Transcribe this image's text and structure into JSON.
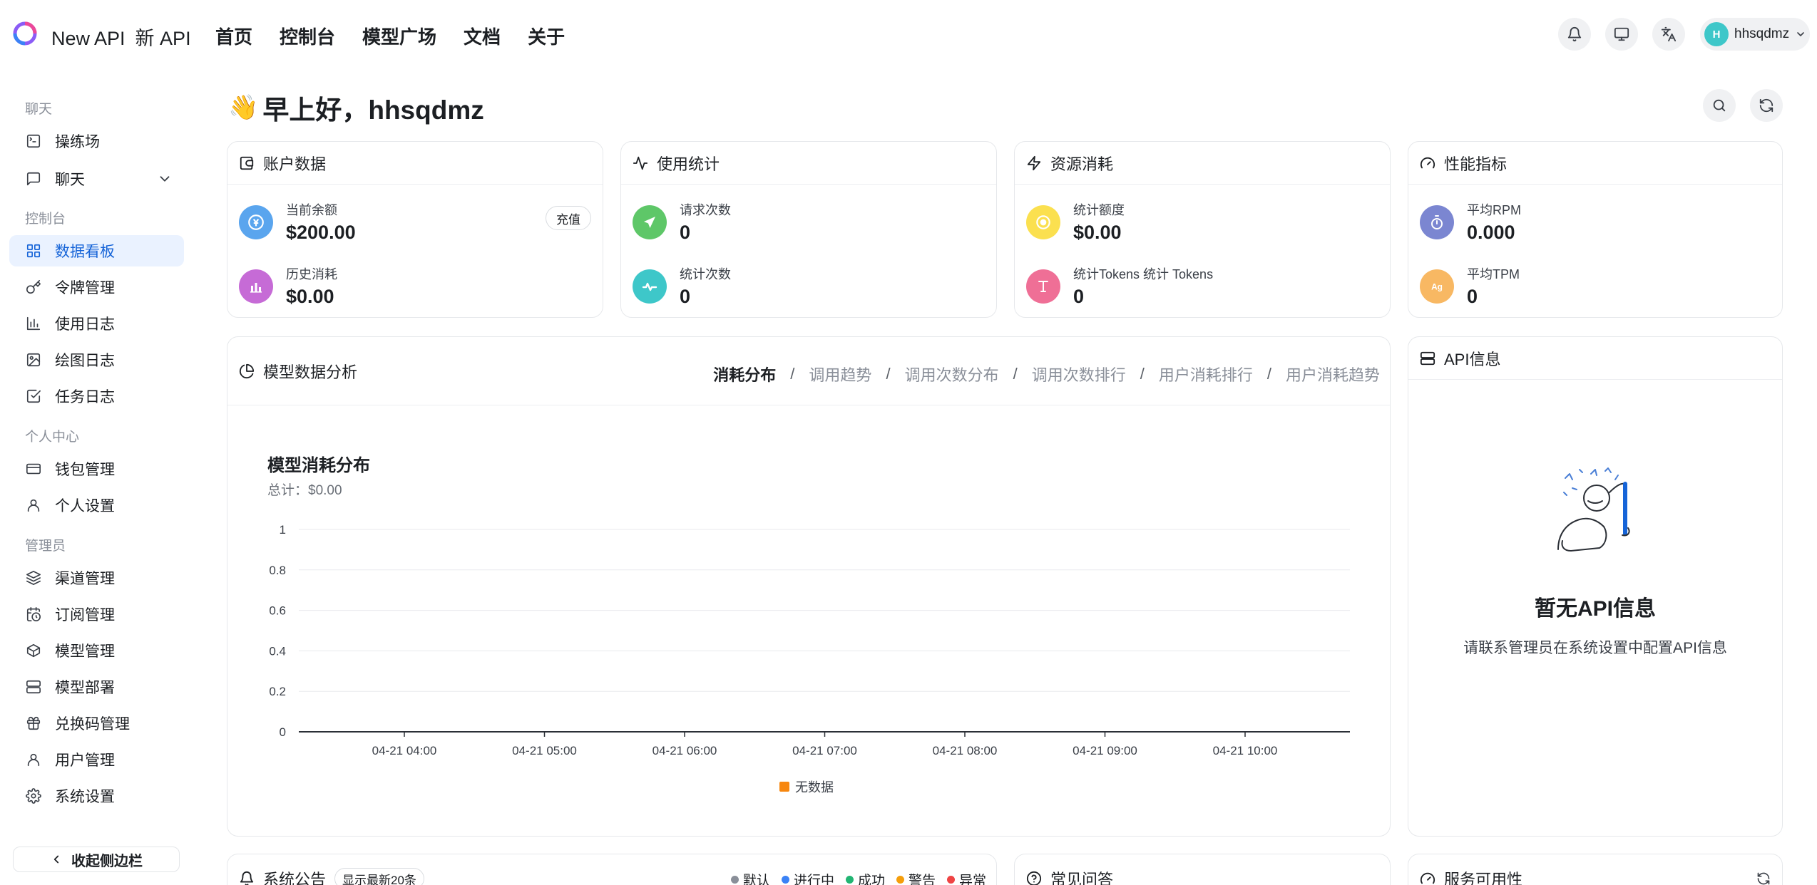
{
  "brand": {
    "name": "New API",
    "name_cn": "新 API"
  },
  "topnav": [
    "首页",
    "控制台",
    "模型广场",
    "文档",
    "关于"
  ],
  "user": {
    "initial": "H",
    "name": "hhsqdmz"
  },
  "sidebar": {
    "groups": [
      "聊天",
      "控制台",
      "个人中心",
      "管理员"
    ],
    "items": [
      "操练场",
      "聊天",
      "数据看板",
      "令牌管理",
      "使用日志",
      "绘图日志",
      "任务日志",
      "钱包管理",
      "个人设置",
      "渠道管理",
      "订阅管理",
      "模型管理",
      "模型部署",
      "兑换码管理",
      "用户管理",
      "系统设置"
    ],
    "collapse_label": "收起侧边栏"
  },
  "greeting": {
    "emoji": "👋",
    "text": "早上好，hhsqdmz"
  },
  "cards": {
    "account": {
      "title": "账户数据",
      "balance_label": "当前余额",
      "balance_value": "$200.00",
      "recharge": "充值",
      "spent_label": "历史消耗",
      "spent_value": "$0.00"
    },
    "usage": {
      "title": "使用统计",
      "requests_label": "请求次数",
      "requests_value": "0",
      "count_label": "统计次数",
      "count_value": "0"
    },
    "resource": {
      "title": "资源消耗",
      "quota_label": "统计额度",
      "quota_value": "$0.00",
      "tokens_label": "统计Tokens  统计 Tokens",
      "tokens_value": "0"
    },
    "performance": {
      "title": "性能指标",
      "rpm_label": "平均RPM",
      "rpm_value": "0.000",
      "tpm_label": "平均TPM",
      "tpm_value": "0"
    }
  },
  "analysis": {
    "title": "模型数据分析",
    "tabs": [
      "消耗分布",
      "调用趋势",
      "调用次数分布",
      "调用次数排行",
      "用户消耗排行",
      "用户消耗趋势"
    ],
    "active_tab": 0
  },
  "chart_data": {
    "type": "bar",
    "title": "模型消耗分布",
    "subtitle": "总计：$0.00",
    "categories": [
      "04-21 04:00",
      "04-21 05:00",
      "04-21 06:00",
      "04-21 07:00",
      "04-21 08:00",
      "04-21 09:00",
      "04-21 10:00"
    ],
    "series": [
      {
        "name": "无数据",
        "values": [
          0,
          0,
          0,
          0,
          0,
          0,
          0
        ],
        "color": "#f7870f"
      }
    ],
    "yticks": [
      "0",
      "0.2",
      "0.4",
      "0.6",
      "0.8",
      "1"
    ],
    "ylim": [
      0,
      1
    ],
    "grid": true,
    "legend": "bottom-center"
  },
  "api_info": {
    "title": "API信息",
    "empty_title": "暂无API信息",
    "empty_desc": "请联系管理员在系统设置中配置API信息"
  },
  "announcements": {
    "title": "系统公告",
    "badge": "显示最新20条",
    "legend": [
      {
        "label": "默认",
        "color": "#8a8f99"
      },
      {
        "label": "进行中",
        "color": "#3b82f6"
      },
      {
        "label": "成功",
        "color": "#22b573"
      },
      {
        "label": "警告",
        "color": "#f59e0b"
      },
      {
        "label": "异常",
        "color": "#ef4444"
      }
    ]
  },
  "faq": {
    "title": "常见问答"
  },
  "service": {
    "title": "服务可用性"
  },
  "colors": {
    "accent": "#1664d8",
    "active_bg": "#eaf2ff"
  }
}
